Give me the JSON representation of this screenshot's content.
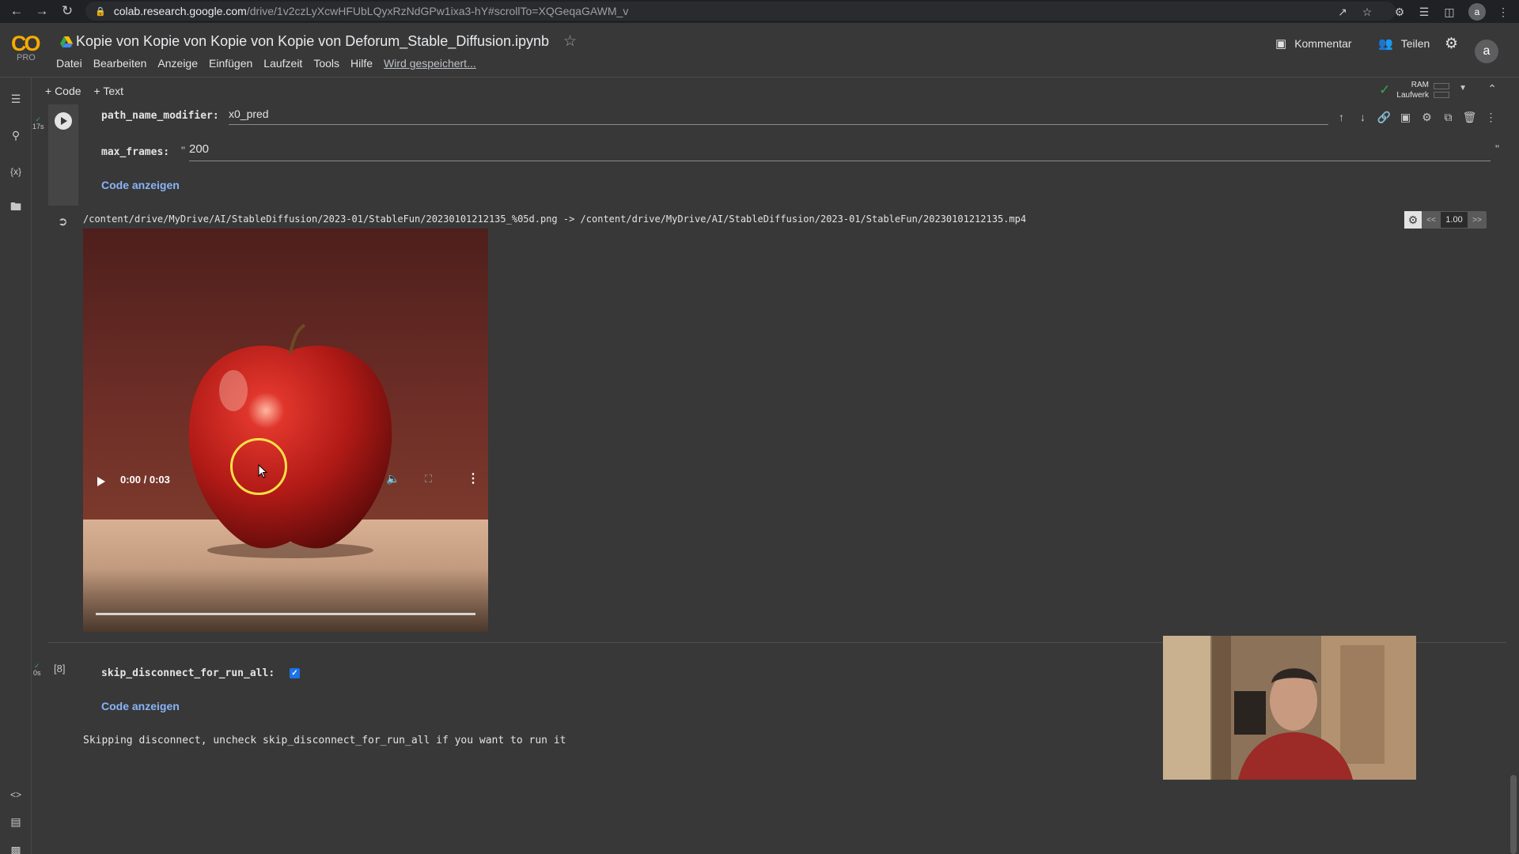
{
  "browser": {
    "url_host": "colab.research.google.com",
    "url_path": "/drive/1v2czLyXcwHFUbLQyxRzNdGPw1ixa3-hY#scrollTo=XQGeqaGAWM_v",
    "avatar_letter": "a"
  },
  "header": {
    "logo_text": "CO",
    "pro_label": "PRO",
    "title": "Kopie von Kopie von Kopie von Kopie von Deforum_Stable_Diffusion.ipynb",
    "menu": [
      "Datei",
      "Bearbeiten",
      "Anzeige",
      "Einfügen",
      "Laufzeit",
      "Tools",
      "Hilfe"
    ],
    "save_status": "Wird gespeichert...",
    "comment_label": "Kommentar",
    "share_label": "Teilen",
    "user_letter": "a"
  },
  "toolbar": {
    "add_code": "+ Code",
    "add_text": "+ Text",
    "ram_label": "RAM",
    "disk_label": "Laufwerk"
  },
  "cell1": {
    "exec_time": "17s",
    "field1_label": "path_name_modifier:",
    "field1_value": "x0_pred",
    "field2_label": "max_frames:",
    "field2_value": "200",
    "quote_open": "\"",
    "quote_close": "\"",
    "show_code": "Code anzeigen",
    "output_path": "/content/drive/MyDrive/AI/StableDiffusion/2023-01/StableFun/20230101212135_%05d.png -> /content/drive/MyDrive/AI/StableDiffusion/2023-01/StableFun/20230101212135.mp4",
    "speed_value": "1.00",
    "speed_prev": "<<",
    "speed_next": ">>",
    "video_time": "0:00 / 0:03",
    "video_progress": 0
  },
  "cell2": {
    "exec_time": "0s",
    "exec_count": "[8]",
    "field_label": "skip_disconnect_for_run_all:",
    "checkbox_checked": true,
    "show_code": "Code anzeigen",
    "output_text": "Skipping disconnect, uncheck skip_disconnect_for_run_all if you want to run it"
  },
  "colors": {
    "accent_link": "#8ab4f8",
    "success": "#34a853",
    "logo": "#f9ab00",
    "checkbox": "#1a73e8"
  }
}
